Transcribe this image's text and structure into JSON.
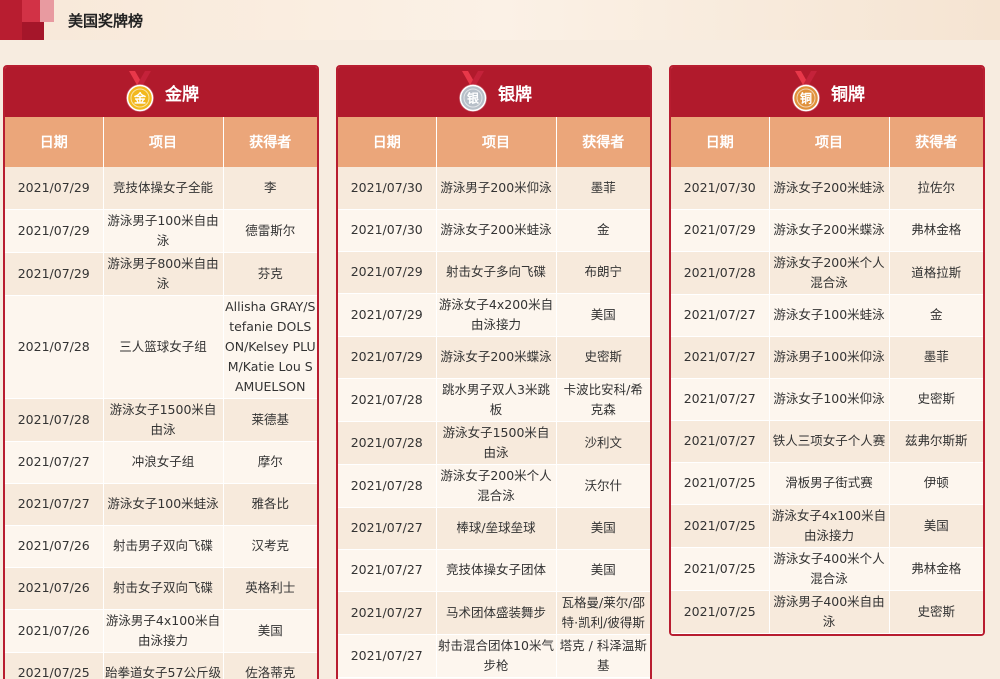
{
  "header": {
    "title": "美国奖牌榜"
  },
  "columns": {
    "date": "日期",
    "event": "项目",
    "winner": "获得者"
  },
  "panels": [
    {
      "id": "gold",
      "label": "金牌",
      "medal_char": "金",
      "medal_color": "#f2b81e",
      "rows": [
        [
          "2021/07/29",
          "竞技体操女子全能",
          "李"
        ],
        [
          "2021/07/29",
          "游泳男子100米自由泳",
          "德雷斯尔"
        ],
        [
          "2021/07/29",
          "游泳男子800米自由泳",
          "芬克"
        ],
        [
          "2021/07/28",
          "三人篮球女子组",
          "Allisha GRAY/Stefanie DOLSON/Kelsey PLUM/Katie Lou SAMUELSON"
        ],
        [
          "2021/07/28",
          "游泳女子1500米自由泳",
          "莱德基"
        ],
        [
          "2021/07/27",
          "冲浪女子组",
          "摩尔"
        ],
        [
          "2021/07/27",
          "游泳女子100米蛙泳",
          "雅各比"
        ],
        [
          "2021/07/26",
          "射击男子双向飞碟",
          "汉考克"
        ],
        [
          "2021/07/26",
          "射击女子双向飞碟",
          "英格利士"
        ],
        [
          "2021/07/26",
          "游泳男子4x100米自由泳接力",
          "美国"
        ],
        [
          "2021/07/25",
          "跆拳道女子57公斤级",
          "佐洛蒂克"
        ]
      ]
    },
    {
      "id": "silver",
      "label": "银牌",
      "medal_char": "银",
      "medal_color": "#b7bfc8",
      "rows": [
        [
          "2021/07/30",
          "游泳男子200米仰泳",
          "墨菲"
        ],
        [
          "2021/07/30",
          "游泳女子200米蛙泳",
          "金"
        ],
        [
          "2021/07/29",
          "射击女子多向飞碟",
          "布朗宁"
        ],
        [
          "2021/07/29",
          "游泳女子4x200米自由泳接力",
          "美国"
        ],
        [
          "2021/07/29",
          "游泳女子200米蝶泳",
          "史密斯"
        ],
        [
          "2021/07/28",
          "跳水男子双人3米跳板",
          "卡波比安科/希克森"
        ],
        [
          "2021/07/28",
          "游泳女子1500米自由泳",
          "沙利文"
        ],
        [
          "2021/07/28",
          "游泳女子200米个人混合泳",
          "沃尔什"
        ],
        [
          "2021/07/27",
          "棒球/垒球垒球",
          "美国"
        ],
        [
          "2021/07/27",
          "竞技体操女子团体",
          "美国"
        ],
        [
          "2021/07/27",
          "马术团体盛装舞步",
          "瓦格曼/莱尔/邵特·凯利/彼得斯"
        ],
        [
          "2021/07/27",
          "射击混合团体10米气步枪",
          "塔克 / 科泽温斯基"
        ]
      ]
    },
    {
      "id": "bronze",
      "label": "铜牌",
      "medal_char": "铜",
      "medal_color": "#e0913a",
      "rows": [
        [
          "2021/07/30",
          "游泳女子200米蛙泳",
          "拉佐尔"
        ],
        [
          "2021/07/29",
          "游泳女子200米蝶泳",
          "弗林金格"
        ],
        [
          "2021/07/28",
          "游泳女子200米个人混合泳",
          "道格拉斯"
        ],
        [
          "2021/07/27",
          "游泳女子100米蛙泳",
          "金"
        ],
        [
          "2021/07/27",
          "游泳男子100米仰泳",
          "墨菲"
        ],
        [
          "2021/07/27",
          "游泳女子100米仰泳",
          "史密斯"
        ],
        [
          "2021/07/27",
          "铁人三项女子个人赛",
          "兹弗尔斯斯"
        ],
        [
          "2021/07/25",
          "滑板男子街式赛",
          "伊顿"
        ],
        [
          "2021/07/25",
          "游泳女子4x100米自由泳接力",
          "美国"
        ],
        [
          "2021/07/25",
          "游泳女子400米个人混合泳",
          "弗林金格"
        ],
        [
          "2021/07/25",
          "游泳男子400米自由泳",
          "史密斯"
        ]
      ]
    }
  ]
}
